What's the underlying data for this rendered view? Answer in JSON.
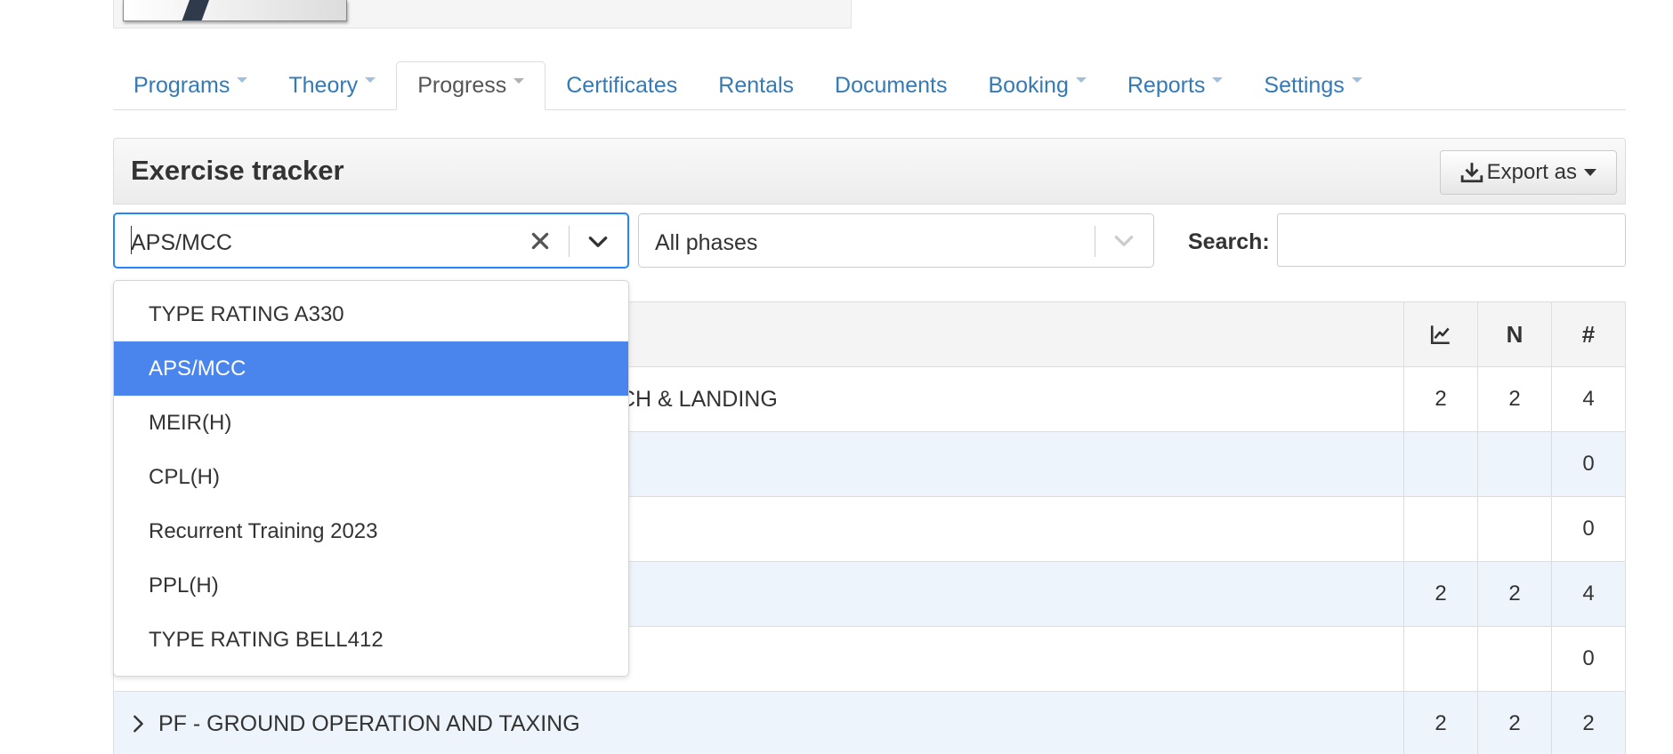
{
  "nav": {
    "tabs": [
      {
        "label": "Programs",
        "dropdown": true,
        "active": false
      },
      {
        "label": "Theory",
        "dropdown": true,
        "active": false
      },
      {
        "label": "Progress",
        "dropdown": true,
        "active": true
      },
      {
        "label": "Certificates",
        "dropdown": false,
        "active": false
      },
      {
        "label": "Rentals",
        "dropdown": false,
        "active": false
      },
      {
        "label": "Documents",
        "dropdown": false,
        "active": false
      },
      {
        "label": "Booking",
        "dropdown": true,
        "active": false
      },
      {
        "label": "Reports",
        "dropdown": true,
        "active": false
      },
      {
        "label": "Settings",
        "dropdown": true,
        "active": false
      }
    ]
  },
  "panel": {
    "title": "Exercise tracker",
    "export_label": "Export as"
  },
  "filters": {
    "program_value": "APS/MCC",
    "phase_value": "All phases",
    "search_label": "Search:",
    "search_value": ""
  },
  "table": {
    "headers": {
      "icon": "chart-line-icon",
      "n": "N",
      "hash": "#"
    },
    "rows": [
      {
        "label": "CH & LANDING",
        "expander": false,
        "c1": "2",
        "c2": "2",
        "c3": "4"
      },
      {
        "label": "",
        "expander": false,
        "c1": "",
        "c2": "",
        "c3": "0"
      },
      {
        "label": "",
        "expander": false,
        "c1": "",
        "c2": "",
        "c3": "0"
      },
      {
        "label": "",
        "expander": false,
        "c1": "2",
        "c2": "2",
        "c3": "4"
      },
      {
        "label": "",
        "expander": false,
        "c1": "",
        "c2": "",
        "c3": "0"
      },
      {
        "label": "PF - GROUND OPERATION AND TAXING",
        "expander": true,
        "c1": "2",
        "c2": "2",
        "c3": "2"
      }
    ]
  },
  "dropdown": {
    "options": [
      {
        "label": "TYPE RATING A330",
        "selected": false
      },
      {
        "label": "APS/MCC",
        "selected": true
      },
      {
        "label": "MEIR(H)",
        "selected": false
      },
      {
        "label": "CPL(H)",
        "selected": false
      },
      {
        "label": "Recurrent Training 2023",
        "selected": false
      },
      {
        "label": "PPL(H)",
        "selected": false
      },
      {
        "label": "TYPE RATING BELL412",
        "selected": false
      }
    ]
  },
  "colors": {
    "link": "#337ab7",
    "focus": "#2684ff",
    "selected_option": "#4a85ee",
    "row_alt": "#eef4fb"
  }
}
